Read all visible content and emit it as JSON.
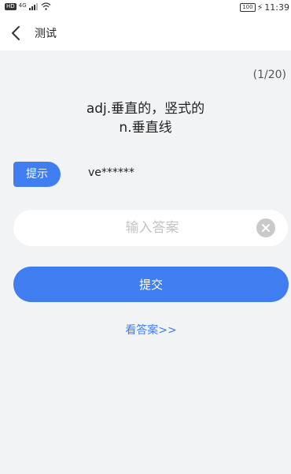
{
  "status_bar": {
    "hd_badge": "HD",
    "signal_label": "4G",
    "battery": "100",
    "time": "11:39"
  },
  "header": {
    "title": "测试"
  },
  "quiz": {
    "progress": "(1/20)",
    "definition_line1": "adj.垂直的，竖式的",
    "definition_line2": "n.垂直线",
    "hint_label": "提示",
    "hint_text": "ve******"
  },
  "answer": {
    "value": "",
    "placeholder": "输入答案"
  },
  "actions": {
    "submit_label": "提交",
    "view_answer_label": "看答案>>"
  },
  "colors": {
    "accent": "#3f7df0",
    "background": "#f2f3f5"
  }
}
